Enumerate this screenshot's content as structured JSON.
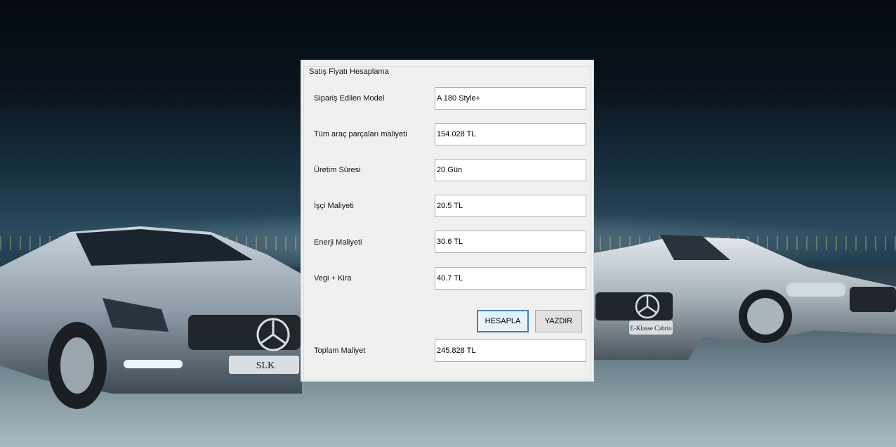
{
  "dialog": {
    "group_title": "Satış Fiyatı Hesaplama",
    "fields": [
      {
        "label": "Sipariş Edilen Model",
        "value": "A 180 Style+"
      },
      {
        "label": "Tüm araç parçaları maliyeti",
        "value": "154.028 TL"
      },
      {
        "label": "Üretim Süresi",
        "value": "20 Gün"
      },
      {
        "label": "İşçi Maliyeti",
        "value": "20.5 TL"
      },
      {
        "label": "Enerji Maliyeti",
        "value": "30.6 TL"
      },
      {
        "label": "Vegi +  Kira",
        "value": "40.7 TL"
      }
    ],
    "calculate_label": "HESAPLA",
    "print_label": "YAZDIR",
    "total": {
      "label": "Toplam Maliyet",
      "value": "245.828 TL"
    }
  },
  "background": {
    "left_car_plate": "SLK",
    "right_car_plate": "E-Klasse Cabrio"
  }
}
